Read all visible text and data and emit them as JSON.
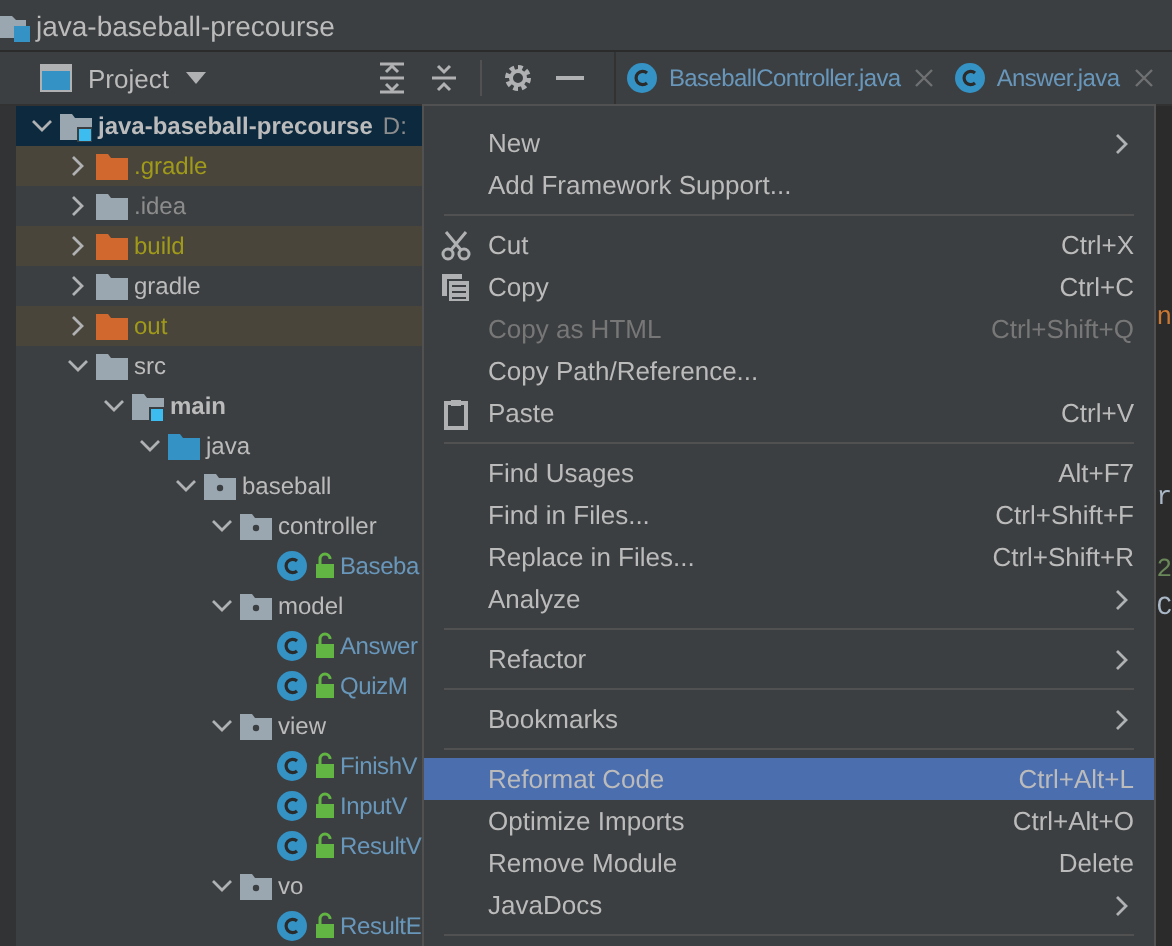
{
  "window": {
    "title": "java-baseball-precourse"
  },
  "tool_window": {
    "title": "Project"
  },
  "tabs": [
    {
      "label": "BaseballController.java",
      "selected": false
    },
    {
      "label": "Answer.java",
      "selected": false
    }
  ],
  "tree": [
    {
      "label": "java-baseball-precourse",
      "path": "D:",
      "kind": "project",
      "expanded": true,
      "selected": true,
      "children": [
        {
          "label": ".gradle",
          "kind": "excluded",
          "expanded": false,
          "selected": false
        },
        {
          "label": ".idea",
          "kind": "hidden",
          "expanded": false,
          "selected": false
        },
        {
          "label": "build",
          "kind": "excluded",
          "expanded": false,
          "selected": false
        },
        {
          "label": "gradle",
          "kind": "folder",
          "expanded": false,
          "selected": false
        },
        {
          "label": "out",
          "kind": "excluded",
          "expanded": false,
          "selected": false
        },
        {
          "label": "src",
          "kind": "folder",
          "expanded": true,
          "selected": false,
          "children": [
            {
              "label": "main",
              "kind": "module",
              "expanded": true,
              "selected": false,
              "children": [
                {
                  "label": "java",
                  "kind": "source",
                  "expanded": true,
                  "selected": false,
                  "children": [
                    {
                      "label": "baseball",
                      "kind": "package",
                      "expanded": true,
                      "selected": false,
                      "children": [
                        {
                          "label": "controller",
                          "kind": "package",
                          "expanded": true,
                          "selected": false,
                          "children": [
                            {
                              "label": "Baseba",
                              "kind": "class",
                              "selected": false
                            }
                          ]
                        },
                        {
                          "label": "model",
                          "kind": "package",
                          "expanded": true,
                          "selected": false,
                          "children": [
                            {
                              "label": "Answer",
                              "kind": "class",
                              "selected": false
                            },
                            {
                              "label": "QuizM",
                              "kind": "class",
                              "selected": false
                            }
                          ]
                        },
                        {
                          "label": "view",
                          "kind": "package",
                          "expanded": true,
                          "selected": false,
                          "children": [
                            {
                              "label": "FinishV",
                              "kind": "class",
                              "selected": false
                            },
                            {
                              "label": "InputV",
                              "kind": "class",
                              "selected": false
                            },
                            {
                              "label": "ResultV",
                              "kind": "class",
                              "selected": false
                            }
                          ]
                        },
                        {
                          "label": "vo",
                          "kind": "package",
                          "expanded": true,
                          "selected": false,
                          "children": [
                            {
                              "label": "ResultE",
                              "kind": "class",
                              "selected": false
                            }
                          ]
                        }
                      ]
                    }
                  ]
                }
              ]
            }
          ]
        }
      ]
    }
  ],
  "editor_fragments": [
    {
      "text": "n",
      "color": "#cc7832"
    },
    {
      "text": "r",
      "color": "#a9b7c6"
    },
    {
      "text": "2",
      "color": "#6a8759"
    },
    {
      "text": "C",
      "color": "#a9b7c6"
    }
  ],
  "context_menu": [
    {
      "kind": "item",
      "label": "New",
      "submenu": true,
      "selected": false,
      "disabled": false
    },
    {
      "kind": "item",
      "label": "Add Framework Support...",
      "selected": false,
      "disabled": false
    },
    {
      "kind": "separator"
    },
    {
      "kind": "item",
      "label": "Cut",
      "shortcut": "Ctrl+X",
      "has_icon": true,
      "selected": false,
      "disabled": false
    },
    {
      "kind": "item",
      "label": "Copy",
      "shortcut": "Ctrl+C",
      "has_icon": true,
      "selected": false,
      "disabled": false
    },
    {
      "kind": "item",
      "label": "Copy as HTML",
      "shortcut": "Ctrl+Shift+Q",
      "selected": false,
      "disabled": true
    },
    {
      "kind": "item",
      "label": "Copy Path/Reference...",
      "selected": false,
      "disabled": false
    },
    {
      "kind": "item",
      "label": "Paste",
      "shortcut": "Ctrl+V",
      "has_icon": true,
      "selected": false,
      "disabled": false
    },
    {
      "kind": "separator"
    },
    {
      "kind": "item",
      "label": "Find Usages",
      "shortcut": "Alt+F7",
      "selected": false,
      "disabled": false
    },
    {
      "kind": "item",
      "label": "Find in Files...",
      "shortcut": "Ctrl+Shift+F",
      "selected": false,
      "disabled": false
    },
    {
      "kind": "item",
      "label": "Replace in Files...",
      "shortcut": "Ctrl+Shift+R",
      "selected": false,
      "disabled": false
    },
    {
      "kind": "item",
      "label": "Analyze",
      "submenu": true,
      "selected": false,
      "disabled": false
    },
    {
      "kind": "separator"
    },
    {
      "kind": "item",
      "label": "Refactor",
      "submenu": true,
      "selected": false,
      "disabled": false
    },
    {
      "kind": "separator"
    },
    {
      "kind": "item",
      "label": "Bookmarks",
      "submenu": true,
      "selected": false,
      "disabled": false
    },
    {
      "kind": "separator"
    },
    {
      "kind": "item",
      "label": "Reformat Code",
      "shortcut": "Ctrl+Alt+L",
      "selected": true,
      "disabled": false
    },
    {
      "kind": "item",
      "label": "Optimize Imports",
      "shortcut": "Ctrl+Alt+O",
      "selected": false,
      "disabled": false
    },
    {
      "kind": "item",
      "label": "Remove Module",
      "shortcut": "Delete",
      "selected": false,
      "disabled": false
    },
    {
      "kind": "item",
      "label": "JavaDocs",
      "submenu": true,
      "selected": false,
      "disabled": false
    },
    {
      "kind": "separator"
    }
  ]
}
